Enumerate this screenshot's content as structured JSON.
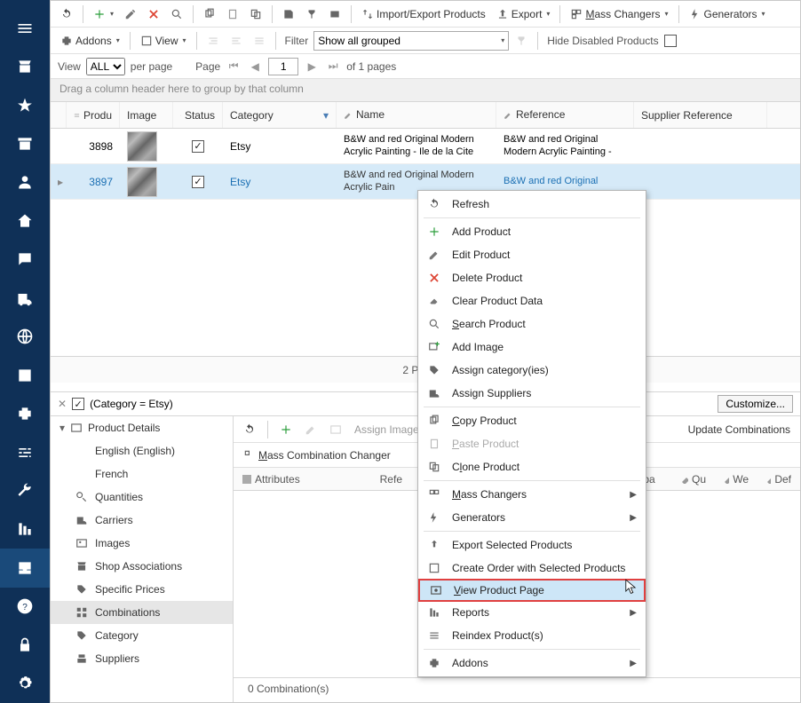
{
  "toolbar": {
    "import_export": "Import/Export Products",
    "export": "Export",
    "mass_changers": "Mass Changers",
    "generators": "Generators",
    "addons": "Addons",
    "view": "View",
    "filter_label": "Filter",
    "filter_value": "Show all grouped",
    "hide_disabled": "Hide Disabled Products"
  },
  "pager": {
    "view": "View",
    "all": "ALL",
    "per_page": "per page",
    "page_label": "Page",
    "page_value": "1",
    "of_pages": "of 1 pages"
  },
  "group_bar": "Drag a column header here to group by that column",
  "columns": {
    "product": "Produ",
    "image": "Image",
    "status": "Status",
    "category": "Category",
    "name": "Name",
    "reference": "Reference",
    "supplier_ref": "Supplier Reference"
  },
  "rows": [
    {
      "id": "3898",
      "category": "Etsy",
      "name": "B&W and red Original Modern Acrylic Painting -  Ile de la Cite",
      "reference": "B&W and red Original Modern Acrylic Painting -"
    },
    {
      "id": "3897",
      "category": "Etsy",
      "name": "B&W and red Original Modern Acrylic Pain",
      "reference": "B&W and red Original"
    }
  ],
  "grid_footer": "2 Product",
  "filter_chip": "(Category = Etsy)",
  "customize": "Customize...",
  "detail_nav": {
    "head": "Product Details",
    "lang1": "English (English)",
    "lang2": "French",
    "quantities": "Quantities",
    "carriers": "Carriers",
    "images": "Images",
    "shop_assoc": "Shop Associations",
    "specific_prices": "Specific Prices",
    "combinations": "Combinations",
    "category": "Category",
    "suppliers": "Suppliers"
  },
  "detail_tb": {
    "assign_images": "Assign Images",
    "update_comb": "Update Combinations",
    "mass_comb": "Mass Combination Changer"
  },
  "attr_head": {
    "attributes": "Attributes",
    "refe": "Refe",
    "impa": "Impa",
    "qu": "Qu",
    "we": "We",
    "def": "Def"
  },
  "comb_footer": "0 Combination(s)",
  "ctx": {
    "refresh": "Refresh",
    "add_product": "Add Product",
    "edit_product": "Edit Product",
    "delete_product": "Delete Product",
    "clear_data": "Clear Product Data",
    "search_product": "Search Product",
    "add_image": "Add Image",
    "assign_cat": "Assign category(ies)",
    "assign_sup": "Assign Suppliers",
    "copy_product": "Copy Product",
    "paste_product": "Paste Product",
    "clone_product": "Clone Product",
    "mass_changers": "Mass Changers",
    "generators": "Generators",
    "export_sel": "Export Selected Products",
    "create_order": "Create Order with Selected Products",
    "view_page": "View Product Page",
    "reports": "Reports",
    "reindex": "Reindex Product(s)",
    "addons": "Addons"
  }
}
